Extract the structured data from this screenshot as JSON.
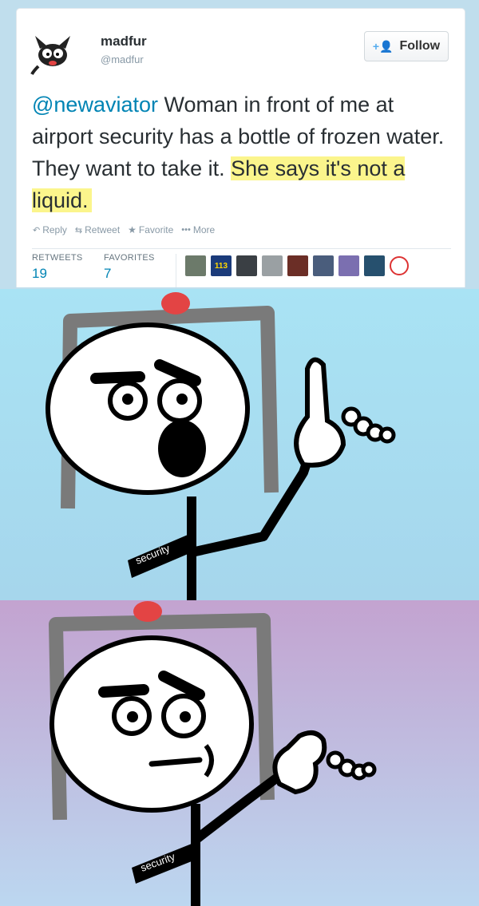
{
  "tweet": {
    "display_name": "madfur",
    "handle": "@madfur",
    "follow_label": "Follow",
    "mention": "@newaviator",
    "text_plain": " Woman in front of me at airport security has a bottle of frozen water. They want to take it. ",
    "text_highlight": "She says it's not a liquid.",
    "actions": {
      "reply": "Reply",
      "retweet": "Retweet",
      "favorite": "Favorite",
      "more": "More"
    },
    "stats": {
      "retweets_label": "RETWEETS",
      "retweets_value": "19",
      "favorites_label": "FAVORITES",
      "favorites_value": "7"
    },
    "avatar_badge": "113"
  },
  "comic": {
    "armband_text": "security",
    "panel1_bg_top": "#a7e2f2",
    "panel1_bg_bottom": "#a5d7ec",
    "panel2_bg_top": "#c2a4d0",
    "panel2_bg_bottom": "#bcd5ef"
  },
  "colors": {
    "link": "#0084b4",
    "highlight": "#fbf58c",
    "siren": "#e34444",
    "detector": "#7d7d7d"
  }
}
